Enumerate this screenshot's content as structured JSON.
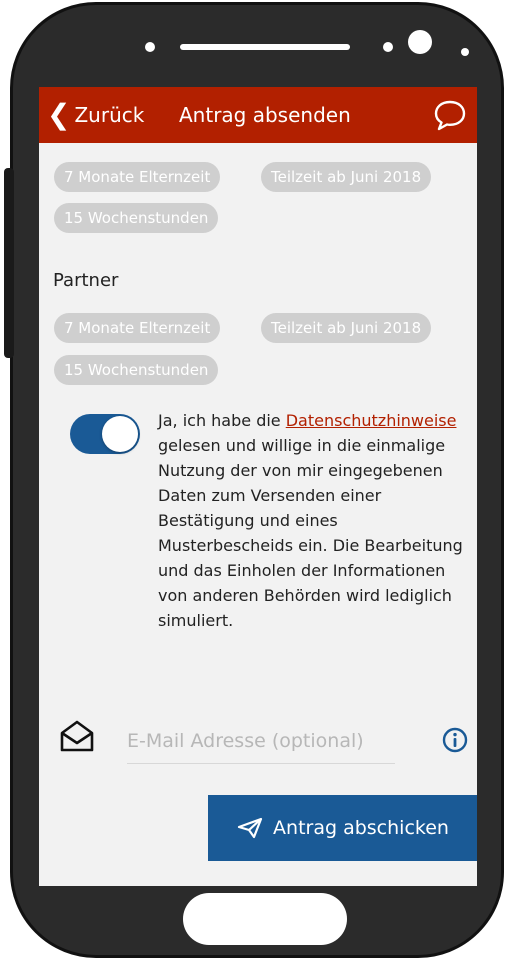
{
  "header": {
    "back_label": "Zurück",
    "title": "Antrag absenden",
    "color": "#b22000"
  },
  "applicant": {
    "chips": [
      "7 Monate Elternzeit",
      "Teilzeit ab Juni 2018",
      "15 Wochenstunden"
    ]
  },
  "partner": {
    "label": "Partner",
    "chips": [
      "7 Monate Elternzeit",
      "Teilzeit ab Juni 2018",
      "15 Wochenstunden"
    ]
  },
  "consent": {
    "toggle_on": true,
    "text_before": "Ja, ich habe die ",
    "link_text": "Datenschutzhinweise",
    "text_after": " gelesen und willige in die einmalige Nutzung der von mir eingegebenen Daten zum Versenden einer Bestätigung und eines Musterbescheids ein. Die Bearbeitung und das Einholen der Informationen von anderen Behörden wird lediglich simuliert."
  },
  "email": {
    "placeholder": "E-Mail Adresse (optional)",
    "value": ""
  },
  "submit": {
    "label": "Antrag abschicken",
    "color": "#1a5a96"
  },
  "icons": {
    "back": "chevron-left-icon",
    "chat": "speech-bubble-icon",
    "mail": "envelope-icon",
    "info": "info-icon",
    "send": "paper-plane-icon"
  }
}
